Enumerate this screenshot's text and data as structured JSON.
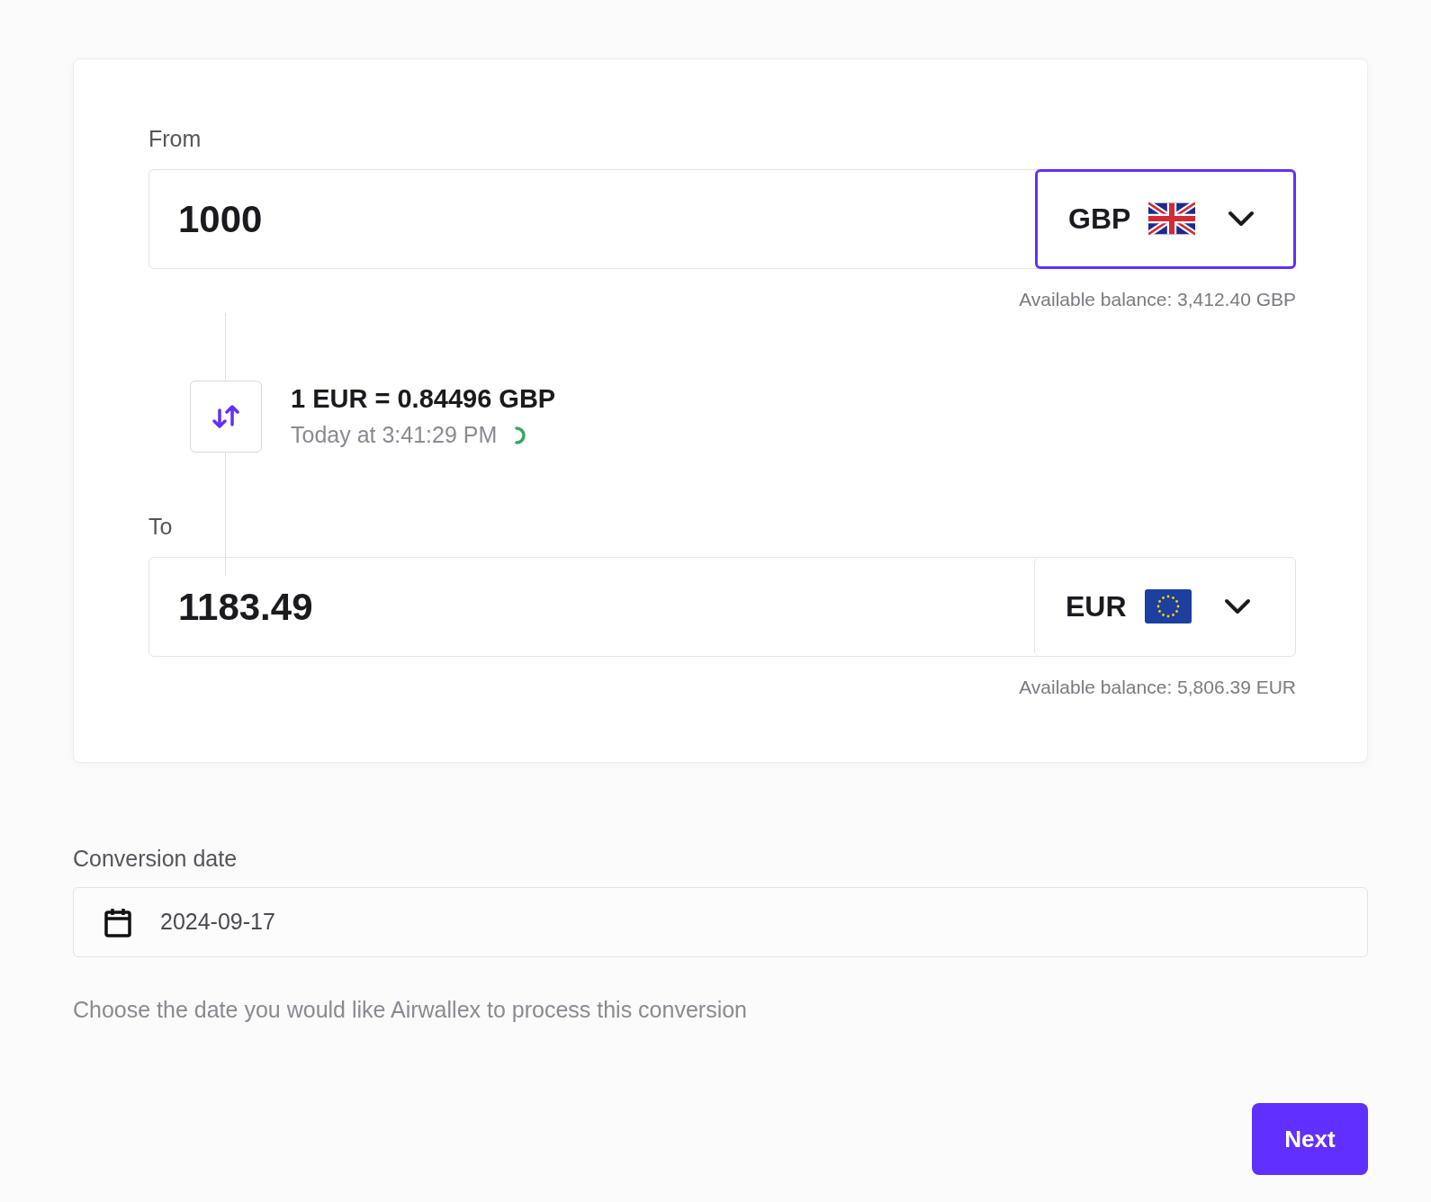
{
  "from": {
    "label": "From",
    "amount": "1000",
    "currency": {
      "code": "GBP",
      "kind": "uk",
      "focused": true
    },
    "balance": "Available balance: 3,412.40 GBP"
  },
  "rate": {
    "text": "1 EUR = 0.84496 GBP",
    "time": "Today at 3:41:29 PM"
  },
  "to": {
    "label": "To",
    "amount": "1183.49",
    "currency": {
      "code": "EUR",
      "kind": "eu",
      "focused": false
    },
    "balance": "Available balance: 5,806.39 EUR"
  },
  "conversion_date": {
    "label": "Conversion date",
    "value": "2024-09-17",
    "help": "Choose the date you would like Airwallex to process this conversion"
  },
  "next_button": "Next"
}
